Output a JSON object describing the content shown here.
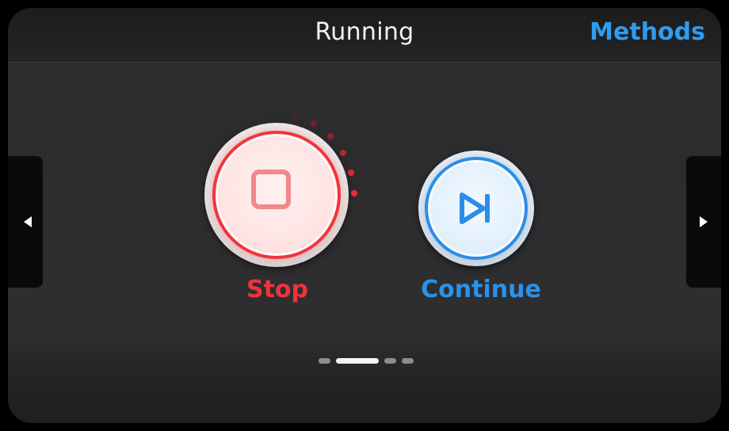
{
  "header": {
    "title": "Running",
    "methods_label": "Methods"
  },
  "controls": {
    "stop_label": "Stop",
    "continue_label": "Continue"
  },
  "pager": {
    "page_count": 4,
    "active_index": 1
  },
  "icons": {
    "left_nav": "triangle-left-icon",
    "right_nav": "triangle-right-icon",
    "stop": "stop-square-icon",
    "continue": "skip-next-icon"
  },
  "colors": {
    "accent_blue": "#2e9cf0",
    "stop_red": "#f0333b",
    "background": "#2e2e30"
  }
}
